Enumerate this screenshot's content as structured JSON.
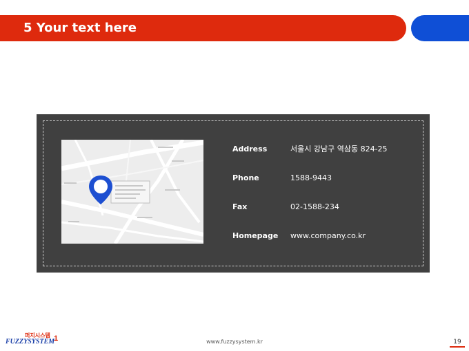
{
  "header": {
    "title": "5 Your text here",
    "accent_color": "#de2a0d",
    "secondary_color": "#0f4fd6"
  },
  "card": {
    "background": "#404040",
    "map_icon": "location-pin-icon",
    "rows": [
      {
        "label": "Address",
        "value": "서울시 강남구 역삼동 824-25"
      },
      {
        "label": "Phone",
        "value": "1588-9443"
      },
      {
        "label": "Fax",
        "value": "02-1588-234"
      },
      {
        "label": "Homepage",
        "value": "www.company.co.kr"
      }
    ]
  },
  "footer": {
    "logo_korean": "퍼지시스템",
    "logo_english": "FUZZYSYSTEM",
    "logo_number": "1",
    "url": "www.fuzzysystem.kr",
    "page_number": "19"
  }
}
